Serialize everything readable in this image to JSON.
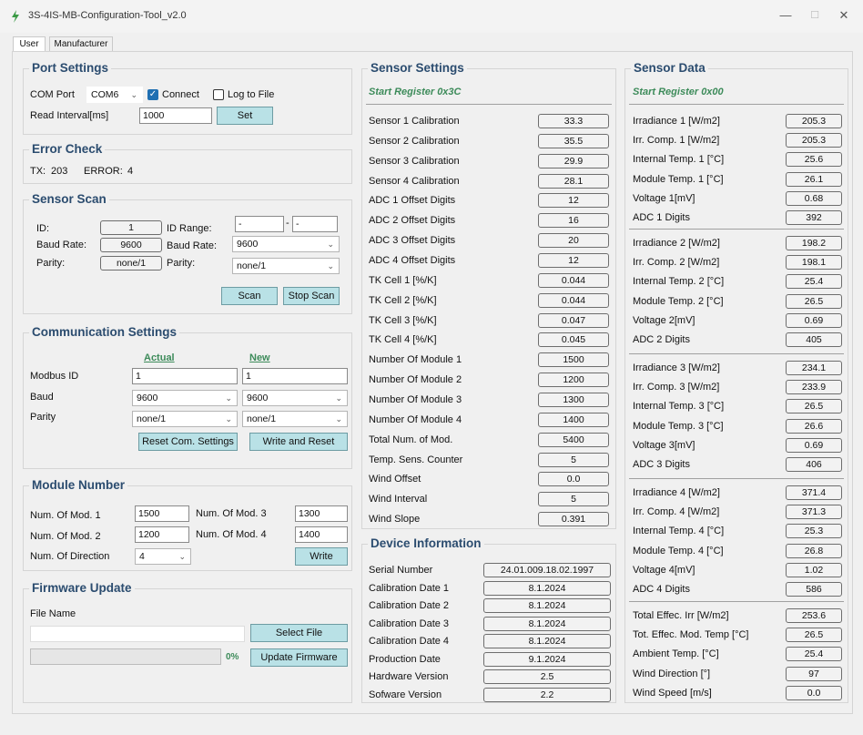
{
  "window": {
    "title": "3S-4IS-MB-Configuration-Tool_v2.0",
    "minimize": "—",
    "maximize": "☐",
    "close": "✕"
  },
  "tabs": [
    "User",
    "Manufacturer"
  ],
  "port_settings": {
    "title": "Port Settings",
    "com_port_label": "COM Port",
    "com_port_value": "COM6",
    "connect_label": "Connect",
    "connect_checked": true,
    "log_label": "Log to File",
    "log_checked": false,
    "interval_label": "Read Interval[ms]",
    "interval_value": "1000",
    "set_button": "Set"
  },
  "error_check": {
    "title": "Error Check",
    "tx_label": "TX:",
    "tx_value": "203",
    "error_label": "ERROR:",
    "error_value": "4"
  },
  "sensor_scan": {
    "title": "Sensor Scan",
    "id_label": "ID:",
    "id_value": "1",
    "baud_label": "Baud Rate:",
    "baud_value": "9600",
    "parity_label": "Parity:",
    "parity_value": "none/1",
    "range_label": "ID Range:",
    "range_from": "-",
    "range_dash": "-",
    "range_to": "-",
    "baud_sel_label": "Baud Rate:",
    "baud_sel_value": "9600",
    "parity_sel_label": "Parity:",
    "parity_sel_value": "none/1",
    "scan_button": "Scan",
    "stop_button": "Stop Scan"
  },
  "comm_settings": {
    "title": "Communication Settings",
    "actual_header": "Actual",
    "new_header": "New",
    "rows": [
      {
        "label": "Modbus ID",
        "actual": "1",
        "new": "1"
      },
      {
        "label": "Baud",
        "actual": "9600",
        "new": "9600"
      },
      {
        "label": "Parity",
        "actual": "none/1",
        "new": "none/1"
      }
    ],
    "reset_button": "Reset Com. Settings",
    "write_reset_button": "Write and Reset"
  },
  "module_number": {
    "title": "Module Number",
    "mod1_label": "Num. Of Mod. 1",
    "mod1_value": "1500",
    "mod2_label": "Num. Of Mod. 2",
    "mod2_value": "1200",
    "mod3_label": "Num. Of Mod. 3",
    "mod3_value": "1300",
    "mod4_label": "Num. Of Mod. 4",
    "mod4_value": "1400",
    "dir_label": "Num. Of Direction",
    "dir_value": "4",
    "write_button": "Write"
  },
  "firmware": {
    "title": "Firmware Update",
    "file_label": "File Name",
    "file_value": "",
    "select_button": "Select File",
    "progress_percent": 0,
    "progress_text": "0%",
    "update_button": "Update Firmware"
  },
  "sensor_settings": {
    "title": "Sensor Settings",
    "subtitle": "Start Register 0x3C",
    "rows": [
      {
        "label": "Sensor 1 Calibration",
        "value": "33.3"
      },
      {
        "label": "Sensor 2 Calibration",
        "value": "35.5"
      },
      {
        "label": "Sensor 3 Calibration",
        "value": "29.9"
      },
      {
        "label": "Sensor 4 Calibration",
        "value": "28.1"
      },
      {
        "label": "ADC 1 Offset Digits",
        "value": "12"
      },
      {
        "label": "ADC 2 Offset Digits",
        "value": "16"
      },
      {
        "label": "ADC 3 Offset Digits",
        "value": "20"
      },
      {
        "label": "ADC 4 Offset Digits",
        "value": "12"
      },
      {
        "label": "TK Cell 1 [%/K]",
        "value": "0.044"
      },
      {
        "label": "TK Cell 2 [%/K]",
        "value": "0.044"
      },
      {
        "label": "TK Cell 3 [%/K]",
        "value": "0.047"
      },
      {
        "label": "TK Cell 4 [%/K]",
        "value": "0.045"
      },
      {
        "label": "Number Of Module 1",
        "value": "1500"
      },
      {
        "label": "Number Of Module 2",
        "value": "1200"
      },
      {
        "label": "Number Of Module 3",
        "value": "1300"
      },
      {
        "label": "Number Of Module 4",
        "value": "1400"
      },
      {
        "label": "Total Num. of Mod.",
        "value": "5400"
      },
      {
        "label": "Temp. Sens. Counter",
        "value": "5"
      },
      {
        "label": "Wind Offset",
        "value": "0.0"
      },
      {
        "label": "Wind Interval",
        "value": "5"
      },
      {
        "label": "Wind Slope",
        "value": "0.391"
      }
    ]
  },
  "device_info": {
    "title": "Device Information",
    "rows": [
      {
        "label": "Serial Number",
        "value": "24.01.009.18.02.1997"
      },
      {
        "label": "Calibration Date 1",
        "value": "8.1.2024"
      },
      {
        "label": "Calibration Date 2",
        "value": "8.1.2024"
      },
      {
        "label": "Calibration Date 3",
        "value": "8.1.2024"
      },
      {
        "label": "Calibration Date 4",
        "value": "8.1.2024"
      },
      {
        "label": "Production Date",
        "value": "9.1.2024"
      },
      {
        "label": "Hardware Version",
        "value": "2.5"
      },
      {
        "label": "Sofware Version",
        "value": "2.2"
      }
    ]
  },
  "sensor_data": {
    "title": "Sensor Data",
    "subtitle": "Start Register 0x00",
    "blocks": [
      [
        {
          "label": "Irradiance 1 [W/m2]",
          "value": "205.3"
        },
        {
          "label": "Irr. Comp. 1 [W/m2]",
          "value": "205.3"
        },
        {
          "label": "Internal Temp. 1 [°C]",
          "value": "25.6"
        },
        {
          "label": "Module Temp. 1 [°C]",
          "value": "26.1"
        },
        {
          "label": "Voltage 1[mV]",
          "value": "0.68"
        },
        {
          "label": "ADC 1 Digits",
          "value": "392"
        }
      ],
      [
        {
          "label": "Irradiance 2 [W/m2]",
          "value": "198.2"
        },
        {
          "label": "Irr. Comp. 2 [W/m2]",
          "value": "198.1"
        },
        {
          "label": "Internal Temp. 2 [°C]",
          "value": "25.4"
        },
        {
          "label": "Module Temp. 2 [°C]",
          "value": "26.5"
        },
        {
          "label": "Voltage 2[mV]",
          "value": "0.69"
        },
        {
          "label": "ADC 2 Digits",
          "value": "405"
        }
      ],
      [
        {
          "label": "Irradiance 3 [W/m2]",
          "value": "234.1"
        },
        {
          "label": "Irr. Comp. 3 [W/m2]",
          "value": "233.9"
        },
        {
          "label": "Internal Temp. 3 [°C]",
          "value": "26.5"
        },
        {
          "label": "Module Temp. 3 [°C]",
          "value": "26.6"
        },
        {
          "label": "Voltage 3[mV]",
          "value": "0.69"
        },
        {
          "label": "ADC 3 Digits",
          "value": "406"
        }
      ],
      [
        {
          "label": "Irradiance 4 [W/m2]",
          "value": "371.4"
        },
        {
          "label": "Irr. Comp. 4 [W/m2]",
          "value": "371.3"
        },
        {
          "label": "Internal Temp. 4 [°C]",
          "value": "25.3"
        },
        {
          "label": "Module Temp. 4 [°C]",
          "value": "26.8"
        },
        {
          "label": "Voltage 4[mV]",
          "value": "1.02"
        },
        {
          "label": "ADC 4 Digits",
          "value": "586"
        }
      ],
      [
        {
          "label": "Total Effec. Irr [W/m2]",
          "value": "253.6"
        },
        {
          "label": "Tot. Effec. Mod. Temp [°C]",
          "value": "26.5"
        },
        {
          "label": "Ambient Temp. [°C]",
          "value": "25.4"
        },
        {
          "label": "Wind Direction [°]",
          "value": "97"
        },
        {
          "label": "Wind Speed [m/s]",
          "value": "0.0"
        }
      ]
    ]
  },
  "colors": {
    "accent_button": "#b9e1e6",
    "group_title": "#2b4c6f",
    "subtitle_green": "#3d8b5a",
    "checkbox_on": "#1f6fb2"
  },
  "icons": {
    "app": "lightning-bolt-icon",
    "dropdown": "chevron-down-icon",
    "check": "check-icon"
  }
}
